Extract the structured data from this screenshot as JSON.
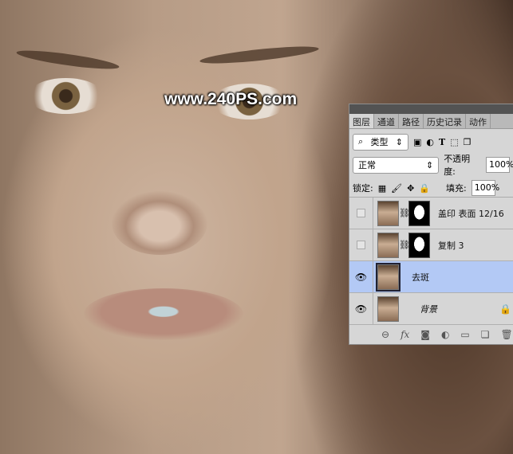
{
  "watermark": "www.240PS.com",
  "panel": {
    "tabs": [
      "图层",
      "通道",
      "路径",
      "历史记录",
      "动作"
    ],
    "filter_label": "类型",
    "blend_mode": "正常",
    "opacity_label": "不透明度:",
    "opacity_value": "100%",
    "lock_label": "锁定:",
    "fill_label": "填充:",
    "fill_value": "100%",
    "layers": [
      {
        "name": "盖印 表面 12/16",
        "visible": false,
        "has_mask": true,
        "selected": false
      },
      {
        "name": "复制 3",
        "visible": false,
        "has_mask": true,
        "selected": false
      },
      {
        "name": "去斑",
        "visible": true,
        "has_mask": false,
        "selected": true
      },
      {
        "name": "背景",
        "visible": true,
        "has_mask": false,
        "selected": false,
        "locked": true
      }
    ],
    "footer_fx": "fx"
  }
}
